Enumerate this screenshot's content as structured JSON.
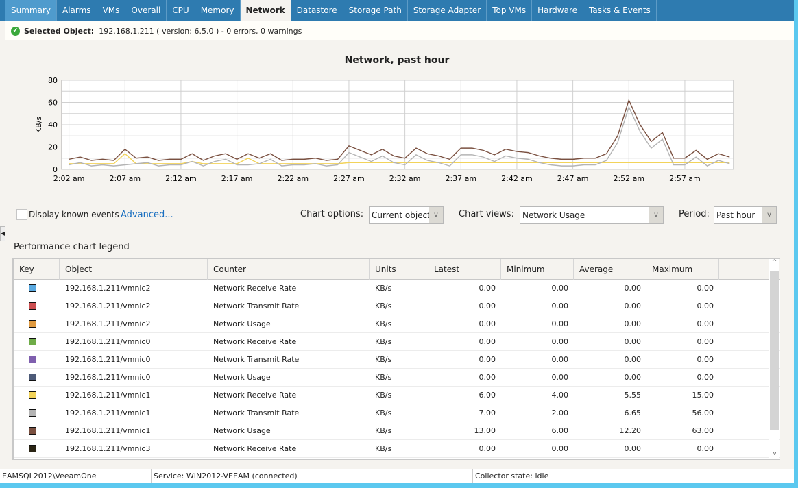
{
  "tabs": [
    "Summary",
    "Alarms",
    "VMs",
    "Overall",
    "CPU",
    "Memory",
    "Network",
    "Datastore",
    "Storage Path",
    "Storage Adapter",
    "Top VMs",
    "Hardware",
    "Tasks & Events"
  ],
  "active_tab": "Network",
  "selected": {
    "label": "Selected Object:",
    "value": "192.168.1.211 ( version: 6.5.0 ) - 0 errors, 0 warnings",
    "icon": "check-circle-icon"
  },
  "controls": {
    "display_events": "Display known events",
    "display_events_checked": false,
    "advanced": "Advanced...",
    "chart_options_label": "Chart options:",
    "chart_options_value": "Current object",
    "chart_views_label": "Chart views:",
    "chart_views_value": "Network Usage",
    "period_label": "Period:",
    "period_value": "Past hour"
  },
  "legend_title": "Performance chart legend",
  "table": {
    "columns": [
      "Key",
      "Object",
      "Counter",
      "Units",
      "Latest",
      "Minimum",
      "Average",
      "Maximum"
    ],
    "rows": [
      {
        "color": "#5aa9e0",
        "object": "192.168.1.211/vmnic2",
        "counter": "Network Receive Rate",
        "units": "KB/s",
        "latest": "0.00",
        "min": "0.00",
        "avg": "0.00",
        "max": "0.00"
      },
      {
        "color": "#cc4e50",
        "object": "192.168.1.211/vmnic2",
        "counter": "Network Transmit Rate",
        "units": "KB/s",
        "latest": "0.00",
        "min": "0.00",
        "avg": "0.00",
        "max": "0.00"
      },
      {
        "color": "#e09a40",
        "object": "192.168.1.211/vmnic2",
        "counter": "Network Usage",
        "units": "KB/s",
        "latest": "0.00",
        "min": "0.00",
        "avg": "0.00",
        "max": "0.00"
      },
      {
        "color": "#6fac48",
        "object": "192.168.1.211/vmnic0",
        "counter": "Network Receive Rate",
        "units": "KB/s",
        "latest": "0.00",
        "min": "0.00",
        "avg": "0.00",
        "max": "0.00"
      },
      {
        "color": "#7f5fae",
        "object": "192.168.1.211/vmnic0",
        "counter": "Network Transmit Rate",
        "units": "KB/s",
        "latest": "0.00",
        "min": "0.00",
        "avg": "0.00",
        "max": "0.00"
      },
      {
        "color": "#4d5a78",
        "object": "192.168.1.211/vmnic0",
        "counter": "Network Usage",
        "units": "KB/s",
        "latest": "0.00",
        "min": "0.00",
        "avg": "0.00",
        "max": "0.00"
      },
      {
        "color": "#f2d35a",
        "object": "192.168.1.211/vmnic1",
        "counter": "Network Receive Rate",
        "units": "KB/s",
        "latest": "6.00",
        "min": "4.00",
        "avg": "5.55",
        "max": "15.00"
      },
      {
        "color": "#b4b4b4",
        "object": "192.168.1.211/vmnic1",
        "counter": "Network Transmit Rate",
        "units": "KB/s",
        "latest": "7.00",
        "min": "2.00",
        "avg": "6.65",
        "max": "56.00"
      },
      {
        "color": "#7a5040",
        "object": "192.168.1.211/vmnic1",
        "counter": "Network Usage",
        "units": "KB/s",
        "latest": "13.00",
        "min": "6.00",
        "avg": "12.20",
        "max": "63.00"
      },
      {
        "color": "#2a2414",
        "object": "192.168.1.211/vmnic3",
        "counter": "Network Receive Rate",
        "units": "KB/s",
        "latest": "0.00",
        "min": "0.00",
        "avg": "0.00",
        "max": "0.00"
      }
    ]
  },
  "status": {
    "user": "EAMSQL2012\\VeeamOne",
    "service": "Service: WIN2012-VEEAM (connected)",
    "collector": "Collector state:  idle"
  },
  "chart_data": {
    "type": "line",
    "title": "Network, past hour",
    "ylabel": "KB/s",
    "ylim": [
      0,
      80
    ],
    "yticks": [
      0,
      20,
      40,
      60,
      80
    ],
    "xticks": [
      "2:02 am",
      "2:07 am",
      "2:12 am",
      "2:17 am",
      "2:22 am",
      "2:27 am",
      "2:32 am",
      "2:37 am",
      "2:42 am",
      "2:47 am",
      "2:52 am",
      "2:57 am"
    ],
    "x_start": "2:02 am",
    "x_interval_minutes": 1,
    "grid": true,
    "series": [
      {
        "name": "192.168.1.211/vmnic1 Network Usage",
        "color": "#7a5040",
        "values": [
          9,
          11,
          8,
          9,
          8,
          18,
          10,
          11,
          8,
          9,
          9,
          14,
          8,
          12,
          14,
          9,
          14,
          10,
          14,
          8,
          9,
          9,
          10,
          8,
          9,
          21,
          17,
          13,
          18,
          12,
          10,
          19,
          14,
          12,
          9,
          19,
          19,
          17,
          13,
          18,
          16,
          15,
          12,
          10,
          9,
          9,
          10,
          10,
          14,
          30,
          62,
          40,
          25,
          33,
          10,
          10,
          17,
          9,
          14,
          11
        ]
      },
      {
        "name": "192.168.1.211/vmnic1 Network Transmit Rate",
        "color": "#b4b4b4",
        "values": [
          4,
          6,
          3,
          4,
          3,
          4,
          5,
          6,
          3,
          4,
          4,
          7,
          3,
          7,
          9,
          4,
          4,
          5,
          9,
          3,
          4,
          4,
          5,
          3,
          4,
          15,
          11,
          7,
          12,
          6,
          4,
          13,
          8,
          6,
          3,
          13,
          13,
          11,
          7,
          12,
          10,
          9,
          6,
          4,
          3,
          3,
          4,
          4,
          8,
          24,
          56,
          34,
          19,
          27,
          4,
          4,
          11,
          3,
          8,
          5
        ]
      },
      {
        "name": "192.168.1.211/vmnic1 Network Receive Rate",
        "color": "#f2d35a",
        "values": [
          5,
          5,
          5,
          5,
          5,
          14,
          5,
          5,
          5,
          5,
          5,
          7,
          5,
          5,
          5,
          5,
          10,
          5,
          5,
          5,
          5,
          5,
          5,
          5,
          5,
          6,
          6,
          6,
          6,
          6,
          6,
          6,
          6,
          6,
          6,
          6,
          6,
          6,
          6,
          6,
          6,
          6,
          6,
          6,
          6,
          6,
          6,
          6,
          6,
          6,
          6,
          6,
          6,
          6,
          6,
          6,
          6,
          6,
          6,
          6
        ]
      }
    ]
  }
}
